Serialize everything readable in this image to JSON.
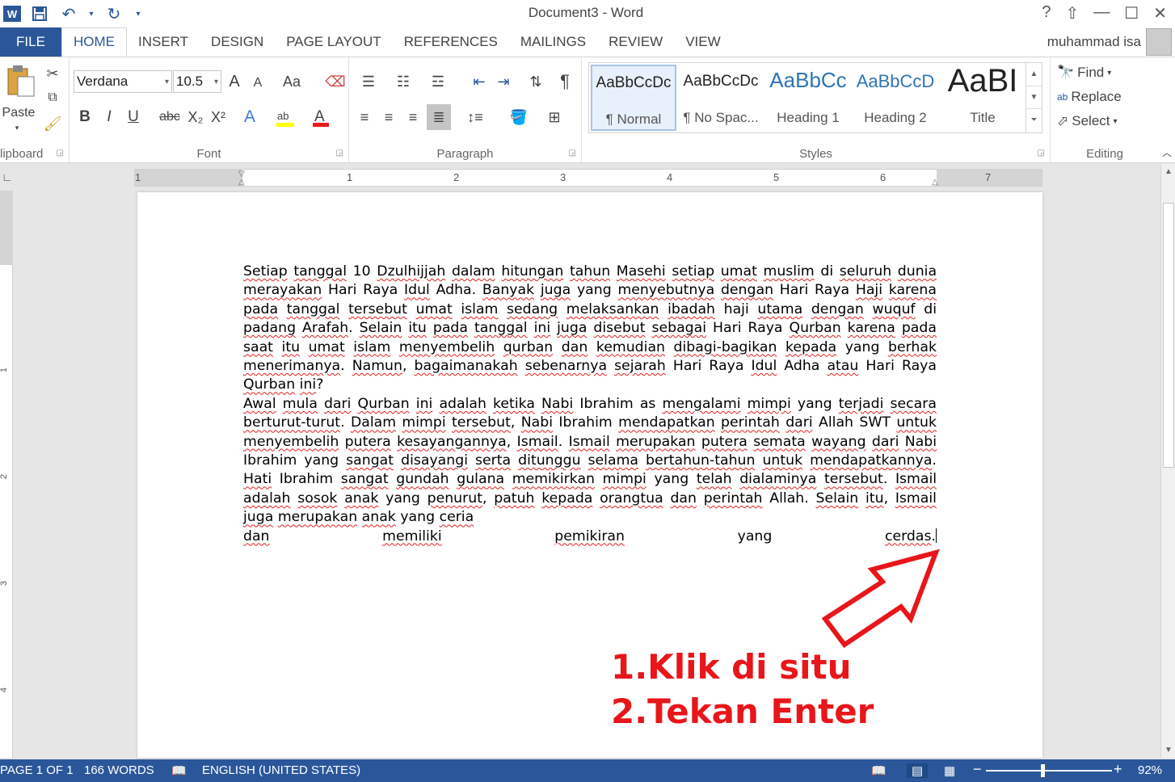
{
  "window": {
    "title": "Document3 - Word",
    "controls": [
      "?",
      "⇧",
      "—",
      "☐",
      "✕"
    ]
  },
  "qat": {
    "undo": "↶",
    "redo": "↻",
    "save": "💾"
  },
  "tabs": [
    {
      "label": "FILE"
    },
    {
      "label": "HOME"
    },
    {
      "label": "INSERT"
    },
    {
      "label": "DESIGN"
    },
    {
      "label": "PAGE LAYOUT"
    },
    {
      "label": "REFERENCES"
    },
    {
      "label": "MAILINGS"
    },
    {
      "label": "REVIEW"
    },
    {
      "label": "VIEW"
    }
  ],
  "user": {
    "name": "muhammad isa"
  },
  "ribbon": {
    "clipboard": {
      "label": "lipboard",
      "paste": "Paste"
    },
    "font": {
      "label": "Font",
      "family": "Verdana",
      "size": "10.5",
      "bold": "B",
      "italic": "I",
      "underline": "U",
      "strike": "abc",
      "sub": "X₂",
      "sup": "X²",
      "grow": "A",
      "shrink": "A",
      "case": "Aa"
    },
    "paragraph": {
      "label": "Paragraph",
      "pilcrow": "¶"
    },
    "styles": {
      "label": "Styles",
      "items": [
        {
          "preview": "AaBbCcDc",
          "name": "¶ Normal"
        },
        {
          "preview": "AaBbCcDc",
          "name": "¶ No Spac..."
        },
        {
          "preview": "AaBbCc",
          "name": "Heading 1"
        },
        {
          "preview": "AaBbCcD",
          "name": "Heading 2"
        },
        {
          "preview": "AaBI",
          "name": "Title"
        }
      ]
    },
    "editing": {
      "label": "Editing",
      "find": "Find",
      "replace": "Replace",
      "select": "Select"
    }
  },
  "ruler": {
    "numbers": [
      "1",
      "1",
      "2",
      "3",
      "4",
      "5",
      "6",
      "7"
    ],
    "vnumbers": [
      "1",
      "2",
      "3",
      "4"
    ]
  },
  "document": {
    "paragraphs": [
      "Setiap tanggal 10 Dzulhijjah dalam hitungan tahun Masehi setiap umat muslim di seluruh dunia merayakan Hari Raya Idul Adha. Banyak juga yang menyebutnya dengan Hari Raya Haji karena pada tanggal tersebut umat islam sedang melaksankan ibadah haji utama dengan wuquf di padang Arafah. Selain itu pada tanggal ini juga disebut sebagai Hari Raya Qurban karena pada saat itu umat islam menyembelih qurban dan kemudian dibagi-bagikan kepada yang berhak menerimanya. Namun, bagaimanakah sebenarnya sejarah Hari Raya Idul Adha atau Hari Raya Qurban ini?",
      "Awal mula dari Qurban ini adalah ketika Nabi Ibrahim as mengalami mimpi yang terjadi secara berturut-turut. Dalam mimpi tersebut, Nabi Ibrahim mendapatkan perintah dari Allah SWT untuk menyembelih putera kesayangannya, Ismail. Ismail merupakan putera semata wayang dari Nabi Ibrahim yang sangat disayangi serta ditunggu selama bertahun-tahun untuk mendapatkannya. Hati Ibrahim sangat gundah gulana memikirkan mimpi yang telah dialaminya tersebut. Ismail adalah sosok anak yang penurut, patuh kepada orangtua dan perintah Allah. Selain itu, Ismail juga merupakan anak yang ceria",
      "dan memiliki pemikiran yang cerdas."
    ]
  },
  "annotation": {
    "line1": "1.Klik di situ",
    "line2": "2.Tekan Enter"
  },
  "status": {
    "page": "PAGE 1 OF 1",
    "words": "166 WORDS",
    "language": "ENGLISH (UNITED STATES)",
    "zoom": "92%",
    "zoom_minus": "−",
    "zoom_plus": "+"
  },
  "colors": {
    "accent": "#2b579a",
    "annotation": "#e8161a"
  }
}
